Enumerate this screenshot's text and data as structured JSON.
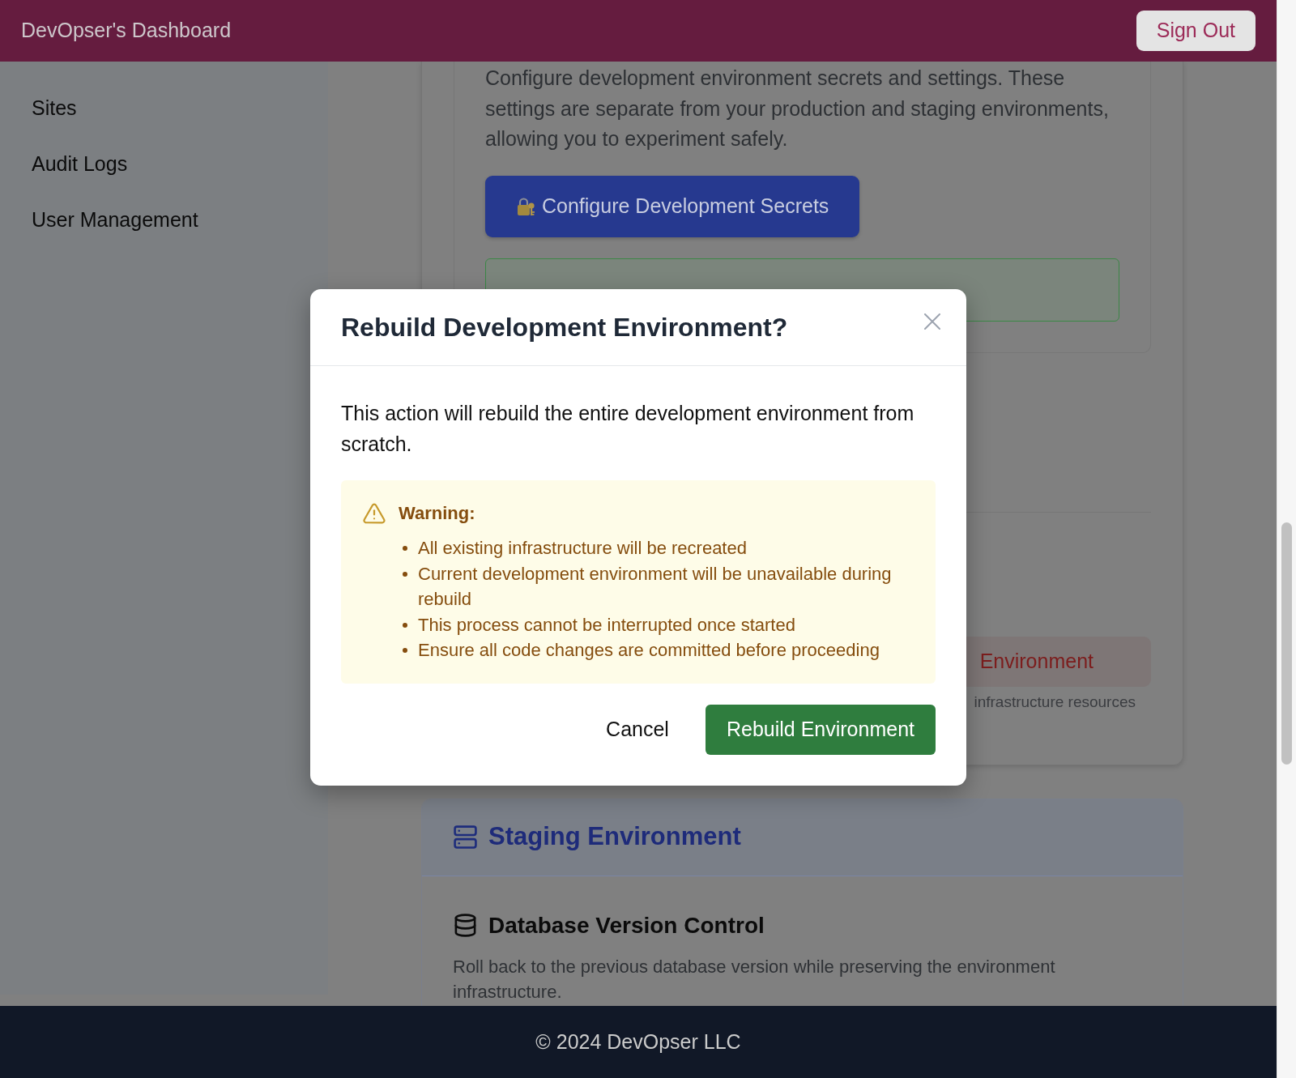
{
  "header": {
    "title": "DevOpser's Dashboard",
    "sign_out": "Sign Out"
  },
  "sidebar": {
    "items": [
      {
        "label": "Sites"
      },
      {
        "label": "Audit Logs"
      },
      {
        "label": "User Management"
      }
    ]
  },
  "development": {
    "description": "Configure development environment secrets and settings. These settings are separate from your production and staging environments, allowing you to experiment safely.",
    "configure_button": "Configure Development Secrets",
    "danger_button": "Environment",
    "danger_note": "infrastructure resources"
  },
  "staging": {
    "title": "Staging Environment",
    "database": {
      "title": "Database Version Control",
      "description": "Roll back to the previous database version while preserving the environment infrastructure."
    }
  },
  "modal": {
    "title": "Rebuild Development Environment?",
    "message": "This action will rebuild the entire development environment from scratch.",
    "warning": {
      "title": "Warning:",
      "items": [
        "All existing infrastructure will be recreated",
        "Current development environment will be unavailable during rebuild",
        "This process cannot be interrupted once started",
        "Ensure all code changes are committed before proceeding"
      ]
    },
    "buttons": [
      {
        "label": "Cancel",
        "kind": "cancel"
      },
      {
        "label": "Rebuild Environment",
        "kind": "confirm"
      }
    ]
  },
  "footer": {
    "text": "© 2024 DevOpser LLC"
  }
}
